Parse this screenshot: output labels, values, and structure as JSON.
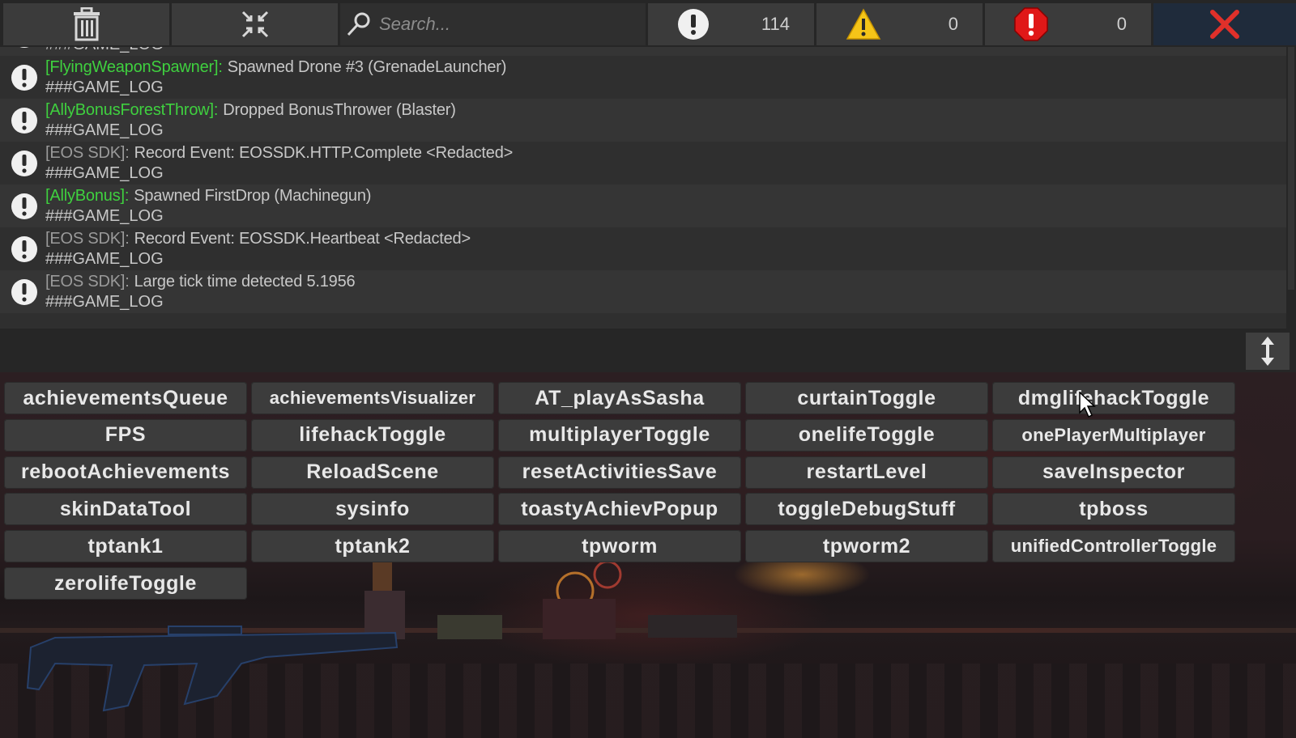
{
  "toolbar": {
    "search_placeholder": "Search...",
    "counts": {
      "info": "114",
      "warning": "0",
      "error": "0"
    },
    "icons": [
      "trash-icon",
      "collapse-icon",
      "search-icon",
      "info-icon",
      "warning-icon",
      "error-icon",
      "close-icon"
    ]
  },
  "log": {
    "entries": [
      {
        "tag": "",
        "tag_color": "",
        "message": "",
        "footer": "###GAME_LOG"
      },
      {
        "tag": "[FlyingWeaponSpawner]:",
        "tag_color": "green",
        "message": "Spawned Drone #3 (GrenadeLauncher)",
        "footer": "###GAME_LOG"
      },
      {
        "tag": "[AllyBonusForestThrow]:",
        "tag_color": "green",
        "message": "Dropped BonusThrower (Blaster)",
        "footer": "###GAME_LOG"
      },
      {
        "tag": "[EOS SDK]:",
        "tag_color": "gray",
        "message": "Record Event: EOSSDK.HTTP.Complete <Redacted>",
        "footer": "###GAME_LOG"
      },
      {
        "tag": "[AllyBonus]:",
        "tag_color": "green",
        "message": "Spawned FirstDrop (Machinegun)",
        "footer": "###GAME_LOG"
      },
      {
        "tag": "[EOS SDK]:",
        "tag_color": "gray",
        "message": "Record Event: EOSSDK.Heartbeat <Redacted>",
        "footer": "###GAME_LOG"
      },
      {
        "tag": "[EOS SDK]:",
        "tag_color": "gray",
        "message": "Large tick time detected 5.1956",
        "footer": "###GAME_LOG"
      }
    ]
  },
  "commands": [
    "achievementsQueue",
    "achievementsVisualizer",
    "AT_playAsSasha",
    "curtainToggle",
    "dmglifehackToggle",
    "FPS",
    "lifehackToggle",
    "multiplayerToggle",
    "onelifeToggle",
    "onePlayerMultiplayer",
    "rebootAchievements",
    "ReloadScene",
    "resetActivitiesSave",
    "restartLevel",
    "saveInspector",
    "skinDataTool",
    "sysinfo",
    "toastyAchievPopup",
    "toggleDebugStuff",
    "tpboss",
    "tptank1",
    "tptank2",
    "tpworm",
    "tpworm2",
    "unifiedControllerToggle",
    "zerolifeToggle"
  ],
  "colors": {
    "tag_green": "#3fd03f",
    "tag_gray": "#9a9a9a",
    "close_red": "#e0302a",
    "warning_yellow": "#f5c518",
    "error_red": "#e01818"
  }
}
